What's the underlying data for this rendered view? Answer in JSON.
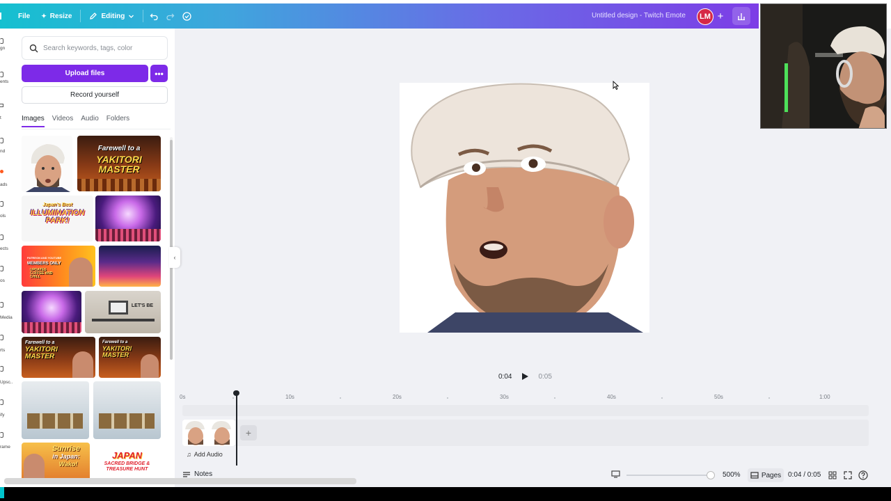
{
  "header": {
    "file_label": "File",
    "resize_label": "Resize",
    "editing_label": "Editing",
    "title": "Untitled design - Twitch Emote",
    "avatar_initials": "LM"
  },
  "rail": {
    "items": [
      "gn",
      "ents",
      "t",
      "nd",
      "ads",
      "ols",
      "ects",
      "os",
      "Media",
      "rts",
      "Upsc...",
      "ify",
      "rame"
    ]
  },
  "panel": {
    "search_placeholder": "Search keywords, tags, color",
    "upload_label": "Upload files",
    "record_label": "Record yourself",
    "tabs": [
      "Images",
      "Videos",
      "Audio",
      "Folders"
    ],
    "thumb_texts": {
      "yakitori_1": "Farewell to a",
      "yakitori_2": "YAKITORI MASTER",
      "illumination_1": "Japan's Best",
      "illumination_2": "ILLUMINATION PARK!",
      "members_1": "PATREON AND YOUTUBE",
      "members_2": "MEMBERS ONLY",
      "members_3": "UPDATES COFFEE AND CHILL",
      "lets_be": "LET'S BE",
      "sunrise_1": "Sunrise",
      "sunrise_2": "in Japan:",
      "sunrise_3": "Wako!",
      "japan_1": "JAPAN",
      "japan_2": "SACRED BRIDGE &",
      "japan_3": "TREASURE HUNT"
    }
  },
  "player": {
    "current_time": "0:04",
    "total_time": "0:05"
  },
  "timeline": {
    "ticks": [
      "0s",
      "10s",
      "20s",
      "30s",
      "40s",
      "50s",
      "1:00"
    ],
    "add_audio_label": "Add Audio"
  },
  "footer": {
    "notes_label": "Notes",
    "zoom": "500%",
    "pages_label": "Pages",
    "page_time": "0:04 / 0:05"
  },
  "colors": {
    "accent": "#7d2ae8",
    "header_start": "#15c0d0",
    "header_end": "#7d3de6",
    "avatar": "#d62846"
  }
}
